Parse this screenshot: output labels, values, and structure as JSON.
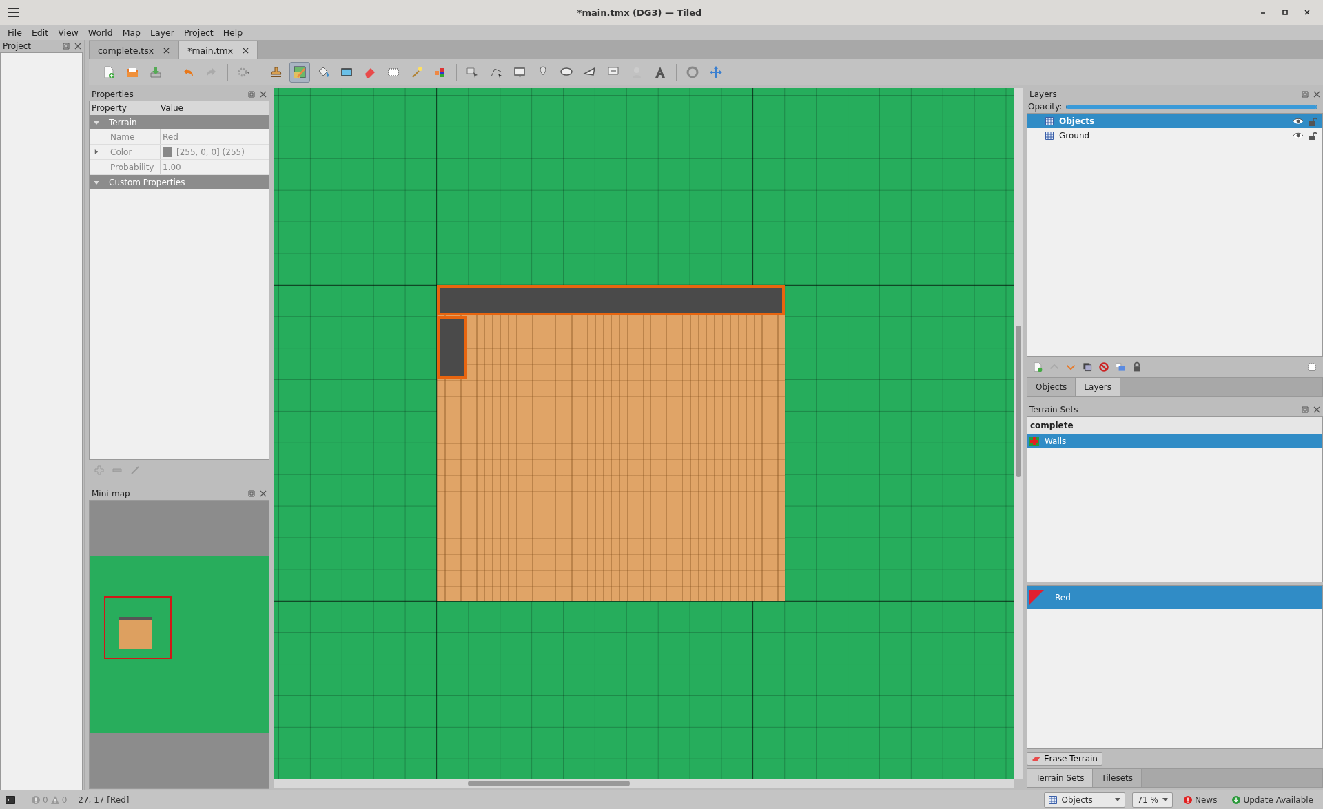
{
  "window": {
    "title": "*main.tmx (DG3) — Tiled"
  },
  "menu": [
    "File",
    "Edit",
    "View",
    "World",
    "Map",
    "Layer",
    "Project",
    "Help"
  ],
  "project_panel": {
    "title": "Project"
  },
  "tabs": [
    {
      "label": "complete.tsx",
      "selected": false
    },
    {
      "label": "*main.tmx",
      "selected": true
    }
  ],
  "toolbar": {
    "groups": [
      {
        "tools": [
          {
            "kind": "new-file",
            "selected": false
          },
          {
            "kind": "open-file",
            "selected": false
          },
          {
            "kind": "save",
            "selected": false
          }
        ]
      },
      {
        "tools": [
          {
            "kind": "undo",
            "selected": false
          },
          {
            "kind": "redo",
            "selected": false
          }
        ]
      },
      {
        "tools": [
          {
            "kind": "commands",
            "selected": false
          }
        ]
      },
      {
        "tools": [
          {
            "kind": "stamp",
            "selected": false
          },
          {
            "kind": "terrain-brush",
            "selected": true
          },
          {
            "kind": "bucket-fill",
            "selected": false
          },
          {
            "kind": "shape-fill",
            "selected": false
          },
          {
            "kind": "eraser",
            "selected": false
          },
          {
            "kind": "rectangle-select",
            "selected": false
          },
          {
            "kind": "magic-wand",
            "selected": false
          },
          {
            "kind": "same-tile-select",
            "selected": false
          }
        ]
      },
      {
        "tools": [
          {
            "kind": "object-select",
            "selected": false
          },
          {
            "kind": "edit-polygons",
            "selected": false
          },
          {
            "kind": "rectangle",
            "selected": false
          },
          {
            "kind": "point",
            "selected": false
          },
          {
            "kind": "ellipse",
            "selected": false
          },
          {
            "kind": "polygon",
            "selected": false
          },
          {
            "kind": "tile-object",
            "selected": false
          },
          {
            "kind": "template",
            "selected": false
          },
          {
            "kind": "text",
            "selected": false
          }
        ]
      },
      {
        "tools": [
          {
            "kind": "rotate",
            "selected": false
          },
          {
            "kind": "move",
            "selected": false
          }
        ]
      }
    ]
  },
  "properties": {
    "title": "Properties",
    "columns": [
      "Property",
      "Value"
    ],
    "groups": [
      {
        "name": "Terrain",
        "expanded": true,
        "rows": [
          {
            "kind": "text",
            "name": "Name",
            "value": "Red"
          },
          {
            "kind": "color",
            "name": "Color",
            "value": "[255, 0, 0] (255)"
          },
          {
            "kind": "text",
            "name": "Probability",
            "value": "1.00"
          }
        ]
      },
      {
        "name": "Custom Properties",
        "expanded": true
      }
    ]
  },
  "minimap": {
    "title": "Mini-map"
  },
  "layers_panel": {
    "title": "Layers",
    "opacity_label": "Opacity:",
    "opacity": {
      "level": 1.0
    },
    "layers": [
      {
        "name": "Objects",
        "selected": true,
        "visible": true,
        "locked": false
      },
      {
        "name": "Ground",
        "selected": false,
        "visible": true,
        "locked": false
      }
    ],
    "tabs": [
      {
        "label": "Objects",
        "selected": false
      },
      {
        "label": "Layers",
        "selected": true
      }
    ]
  },
  "terrain_panel": {
    "title": "Terrain Sets",
    "tileset": "complete",
    "terrain_sets": [
      {
        "name": "Walls",
        "selected": true
      }
    ],
    "terrains": [
      {
        "name": "Red",
        "selected": true
      }
    ],
    "erase_button": "Erase Terrain",
    "tabs": [
      {
        "label": "Terrain Sets",
        "selected": true
      },
      {
        "label": "Tilesets",
        "selected": false
      }
    ]
  },
  "status_bar": {
    "errors": "0",
    "warnings": "0",
    "position": "27, 17 [Red]",
    "layer": "Objects",
    "zoom": "71 %",
    "news": "News",
    "update": "Update Available"
  }
}
